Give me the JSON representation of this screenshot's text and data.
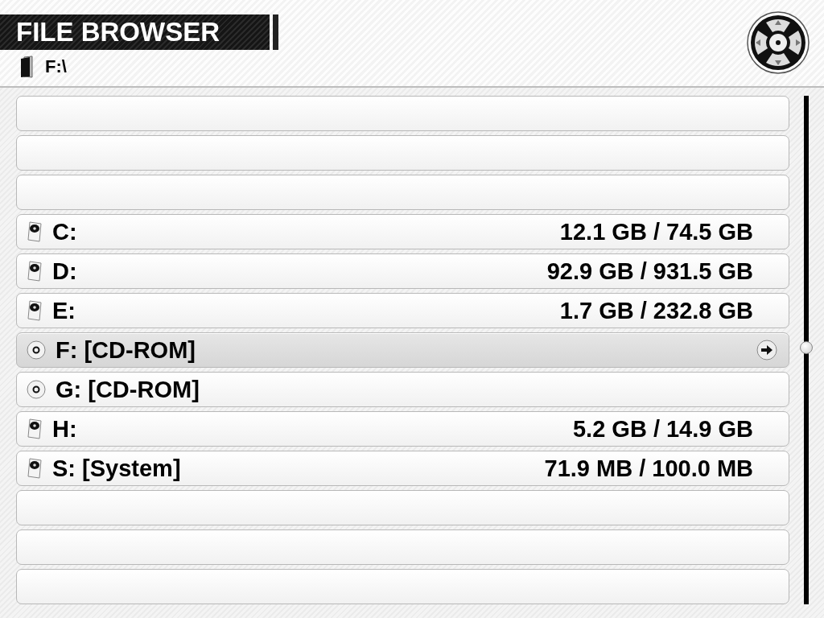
{
  "window": {
    "title": "FILE BROWSER"
  },
  "path": "F:\\",
  "rows": [
    {
      "kind": "empty",
      "selected": false
    },
    {
      "kind": "empty",
      "selected": false
    },
    {
      "kind": "empty",
      "selected": false
    },
    {
      "kind": "hdd",
      "name": "C:",
      "usage": "12.1 GB / 74.5 GB",
      "selected": false
    },
    {
      "kind": "hdd",
      "name": "D:",
      "usage": "92.9 GB / 931.5 GB",
      "selected": false
    },
    {
      "kind": "hdd",
      "name": "E:",
      "usage": "1.7 GB / 232.8 GB",
      "selected": false
    },
    {
      "kind": "cdrom",
      "name": "F: [CD-ROM]",
      "selected": true
    },
    {
      "kind": "cdrom",
      "name": "G: [CD-ROM]",
      "selected": false
    },
    {
      "kind": "hdd",
      "name": "H:",
      "usage": "5.2 GB / 14.9 GB",
      "selected": false
    },
    {
      "kind": "hdd",
      "name": "S: [System]",
      "usage": "71.9 MB / 100.0 MB",
      "selected": false
    },
    {
      "kind": "empty",
      "selected": false
    },
    {
      "kind": "empty",
      "selected": false
    },
    {
      "kind": "empty",
      "selected": false
    }
  ]
}
